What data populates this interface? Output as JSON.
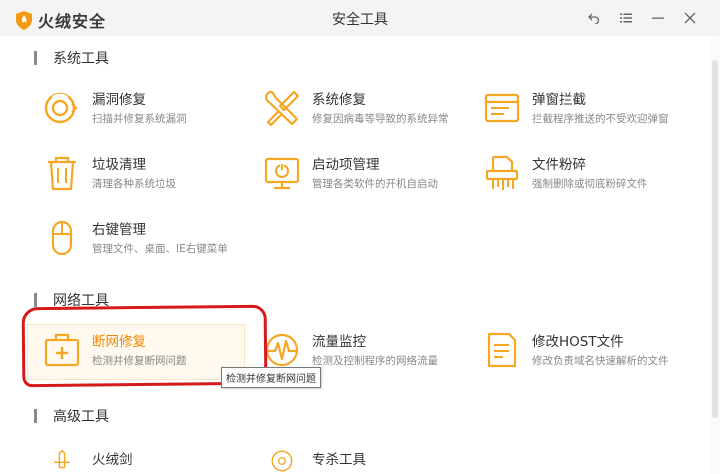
{
  "app": {
    "name": "火绒安全",
    "window_title": "安全工具",
    "accent_color": "#f5a623",
    "highlight_color": "#d41a1a"
  },
  "window_controls": [
    {
      "icon": "back-icon"
    },
    {
      "icon": "menu-icon"
    },
    {
      "icon": "minimize-icon"
    },
    {
      "icon": "close-icon"
    }
  ],
  "sections": {
    "system": {
      "title": "系统工具"
    },
    "network": {
      "title": "网络工具"
    },
    "advanced": {
      "title": "高级工具"
    }
  },
  "tools": {
    "vuln_repair": {
      "name": "漏洞修复",
      "desc": "扫描并修复系统漏洞",
      "icon": "vulnerability-repair-icon"
    },
    "system_repair": {
      "name": "系统修复",
      "desc": "修复因病毒等导致的系统异常",
      "icon": "wrench-screwdriver-icon"
    },
    "popup_block": {
      "name": "弹窗拦截",
      "desc": "拦截程序推送的不受欢迎弹窗",
      "icon": "popup-window-icon"
    },
    "junk_clean": {
      "name": "垃圾清理",
      "desc": "清理各种系统垃圾",
      "icon": "trash-icon"
    },
    "startup_mgr": {
      "name": "启动项管理",
      "desc": "管理各类软件的开机自启动",
      "icon": "monitor-power-icon"
    },
    "file_shred": {
      "name": "文件粉碎",
      "desc": "强制删除或彻底粉碎文件",
      "icon": "shredder-icon"
    },
    "context_menu": {
      "name": "右键管理",
      "desc": "管理文件、桌面、IE右键菜单",
      "icon": "mouse-icon"
    },
    "net_repair": {
      "name": "断网修复",
      "desc": "检测并修复断网问题",
      "icon": "first-aid-kit-icon"
    },
    "traffic_mon": {
      "name": "流量监控",
      "desc": "检测及控制程序的网络流量",
      "icon": "traffic-pulse-icon"
    },
    "host_edit": {
      "name": "修改HOST文件",
      "desc": "修改负责域名快速解析的文件",
      "icon": "document-edit-icon"
    },
    "sword": {
      "name": "火绒剑",
      "icon": "sword-icon"
    },
    "special_kill": {
      "name": "专杀工具",
      "icon": "special-kill-icon"
    }
  },
  "tooltip": {
    "text": "检测并修复断网问题"
  }
}
